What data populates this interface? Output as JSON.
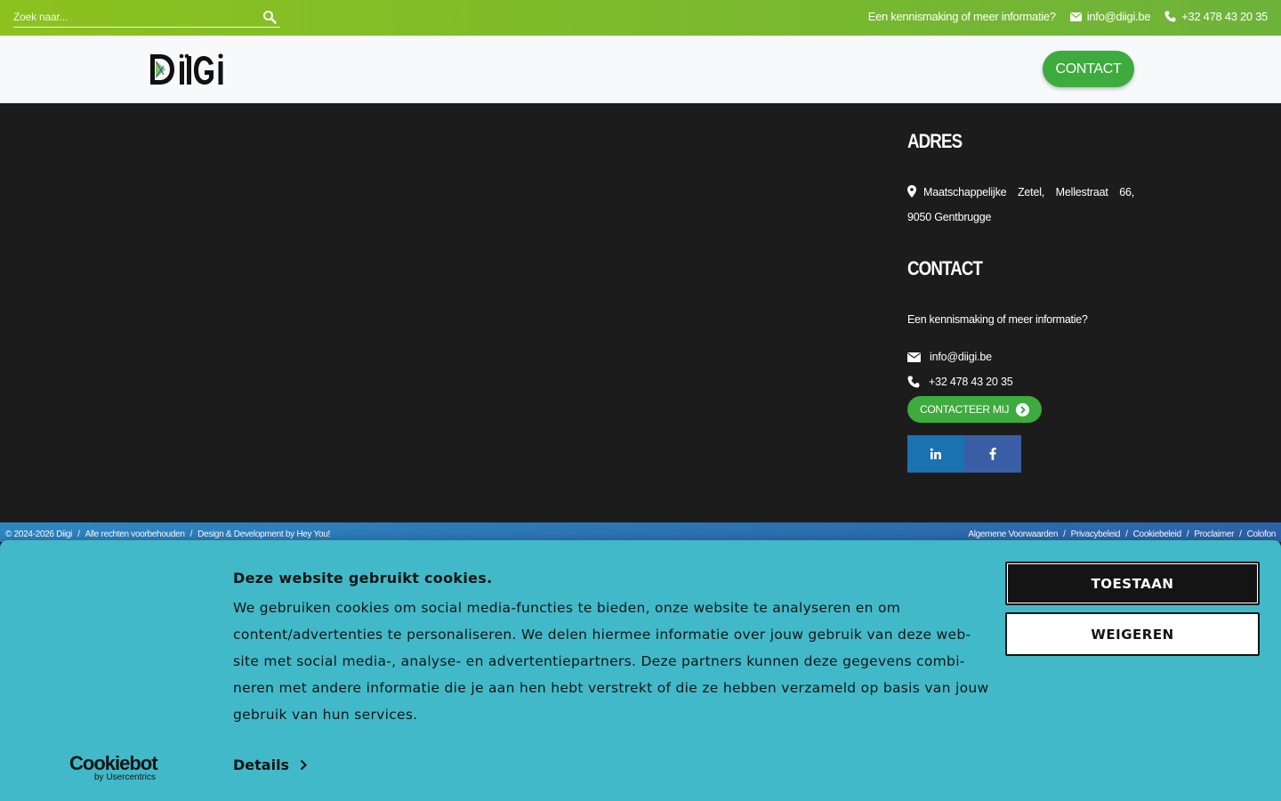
{
  "topbar": {
    "search_placeholder": "Zoek naar...",
    "info_text": "Een kennismaking of meer informatie?",
    "email": "info@diigi.be",
    "phone": "+32 478 43 20 35"
  },
  "header": {
    "logo_text": "DïiGi",
    "contact_label": "CONTACT"
  },
  "address": {
    "title": "ADRES",
    "line": "Maatschappelijke Zetel, Mellestraat 66, 9050 Gentbrugge"
  },
  "contact": {
    "title": "CONTACT",
    "intro": "Een kennismaking of meer informatie?",
    "email": "info@diigi.be",
    "phone": "+32 478 43 20 35",
    "cta_label": "CONTACTEER MIJ",
    "social": [
      "linkedin-icon",
      "facebook-icon"
    ]
  },
  "footer": {
    "copyright": "© 2024-2026 Diigi",
    "rights": "Alle rechten voorbehouden",
    "credit": "Design & Development by Hey You!",
    "links": [
      "Algemene Voorwaarden",
      "Privacybeleid",
      "Cookiebeleid",
      "Proclaimer",
      "Colofon"
    ]
  },
  "cookie": {
    "brand": "Cookiebot",
    "brand_sub": "by Usercentrics",
    "title": "Deze website gebruikt cookies.",
    "body": "We gebruiken cookies om social media-functies te bieden, onze website te analyseren en om content/advertenties te personaliseren. We delen hiermee informatie over jouw gebruik van deze web-site met social media-, analyse- en advertentiepartners. Deze partners kunnen deze gegevens combi-neren met andere informatie die je aan hen hebt verstrekt of die ze hebben verzameld op basis van jouw gebruik van hun services.",
    "details_label": "Details",
    "allow_label": "TOESTAAN",
    "deny_label": "WEIGEREN"
  },
  "colors": {
    "green": "#3dab3d",
    "topbar": "#8cc21f",
    "dark": "#1c1c1c",
    "cookie_bg": "#42b9c8",
    "footer_blue": "#2c63a8"
  }
}
